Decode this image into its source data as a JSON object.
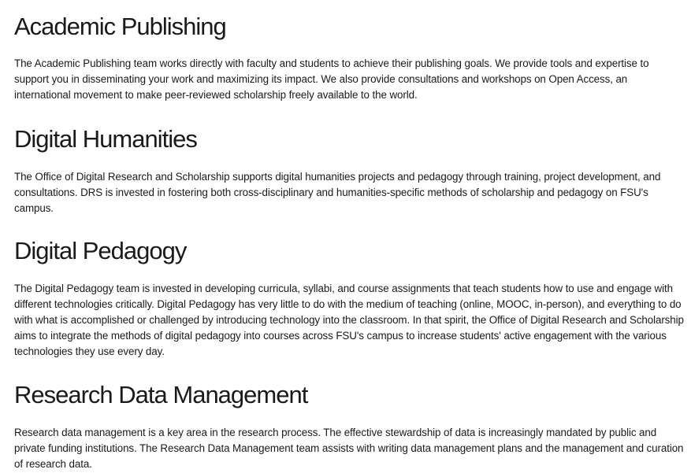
{
  "sections": [
    {
      "title": "Academic Publishing",
      "body": "The Academic Publishing team works directly with faculty and students to achieve their publishing goals. We provide tools and expertise to support you in disseminating your work and maximizing its impact. We also provide consultations and workshops on Open Access, an international movement to make peer-reviewed scholarship freely available to the world."
    },
    {
      "title": "Digital Humanities",
      "body": "The Office of Digital Research and Scholarship supports digital humanities projects and pedagogy through training, project development, and consultations. DRS is invested in fostering both cross-disciplinary and humanities-specific methods of scholarship and pedagogy on FSU's campus."
    },
    {
      "title": "Digital Pedagogy",
      "body": "The Digital Pedagogy team is invested in developing curricula, syllabi, and course assignments that teach students how to use and engage with different technologies critically. Digital Pedagogy has very little to do with the medium of teaching (online, MOOC, in-person), and everything to do with what is accomplished or challenged by introducing technology into the classroom. In that spirit, the Office of Digital Research and Scholarship aims to integrate the methods of digital pedagogy into courses across FSU's campus to increase students' active engagement with the various technologies they use every day."
    },
    {
      "title": "Research Data Management",
      "body": "Research data management is a key area in the research process. The effective stewardship of data is increasingly mandated by public and private funding institutions. The Research Data Management team assists with writing data management plans and the management and curation of research data."
    }
  ]
}
